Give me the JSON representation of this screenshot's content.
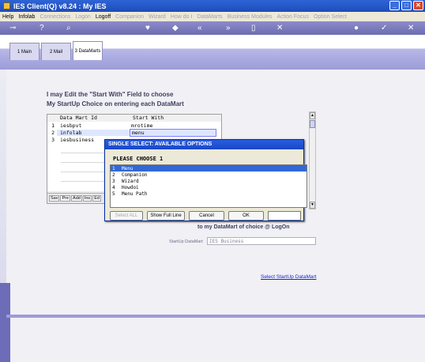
{
  "window": {
    "title": "IES Client(Q) v8.24 : My IES",
    "buttons": {
      "minimize": "_",
      "maximize": "□",
      "close": "✕"
    }
  },
  "menubar": {
    "items": [
      {
        "label": "Help",
        "enabled": true
      },
      {
        "label": "Infolab",
        "enabled": true
      },
      {
        "label": "Connections",
        "enabled": false
      },
      {
        "label": "Logon",
        "enabled": false
      },
      {
        "label": "Logoff",
        "enabled": true
      },
      {
        "label": "Companion",
        "enabled": false
      },
      {
        "label": "Wizard",
        "enabled": false
      },
      {
        "label": "How do I",
        "enabled": false
      },
      {
        "label": "DataMarts",
        "enabled": false
      },
      {
        "label": "Business Modules",
        "enabled": false
      },
      {
        "label": "Action Focus",
        "enabled": false
      },
      {
        "label": "Option Select",
        "enabled": false
      }
    ]
  },
  "toolbar": {
    "icons": [
      "key-icon",
      "help-icon",
      "search-icon",
      "heart-icon",
      "bookmark-icon",
      "rewind-icon",
      "forward-icon",
      "document-icon",
      "nav-icon",
      "globe-icon",
      "check-icon",
      "close-icon"
    ]
  },
  "tabs": [
    {
      "label": "1 Main",
      "active": false
    },
    {
      "label": "2 Mail",
      "active": false
    },
    {
      "label": "3 DataMarts",
      "active": true
    }
  ],
  "instruction": {
    "line1": "I may Edit the \"Start With\" Field to choose",
    "line2": "My StartUp Choice on entering each DataMart"
  },
  "grid": {
    "headers": [
      "Data Mart Id",
      "Start With"
    ],
    "rows": [
      {
        "num": "1",
        "id": "iesbpvt",
        "start": "mrotime",
        "selected": false
      },
      {
        "num": "2",
        "id": "infolab",
        "start": "menu",
        "selected": true
      },
      {
        "num": "3",
        "id": "iesbusiness",
        "start": "",
        "selected": false
      }
    ],
    "nav": [
      "Sav",
      "Pre",
      "Add",
      "Ins",
      "Ed"
    ]
  },
  "dialog": {
    "title": "SINGLE SELECT: AVAILABLE OPTIONS",
    "heading": "PLEASE CHOOSE 1",
    "options": [
      {
        "num": "1",
        "label": "Menu",
        "selected": true
      },
      {
        "num": "2",
        "label": "Companion",
        "selected": false
      },
      {
        "num": "3",
        "label": "Wizard",
        "selected": false
      },
      {
        "num": "4",
        "label": "Howdoi",
        "selected": false
      },
      {
        "num": "5",
        "label": "Menu Path",
        "selected": false
      }
    ],
    "buttons": {
      "select_all": "Select ALL",
      "show_full_line": "Show Full Line",
      "cancel": "Cancel",
      "ok": "OK"
    },
    "input_value": ""
  },
  "choice_text": "to my DataMart of choice @ LogOn",
  "startup": {
    "label": "StartUp DataMart",
    "value": "IES Business"
  },
  "select_link": "Select StartUp DataMart",
  "colors": {
    "titlebar": "#1d4cb8",
    "toolbar": "#7c7cc0",
    "accent": "#9c9cd8",
    "link": "#1a24c8"
  }
}
